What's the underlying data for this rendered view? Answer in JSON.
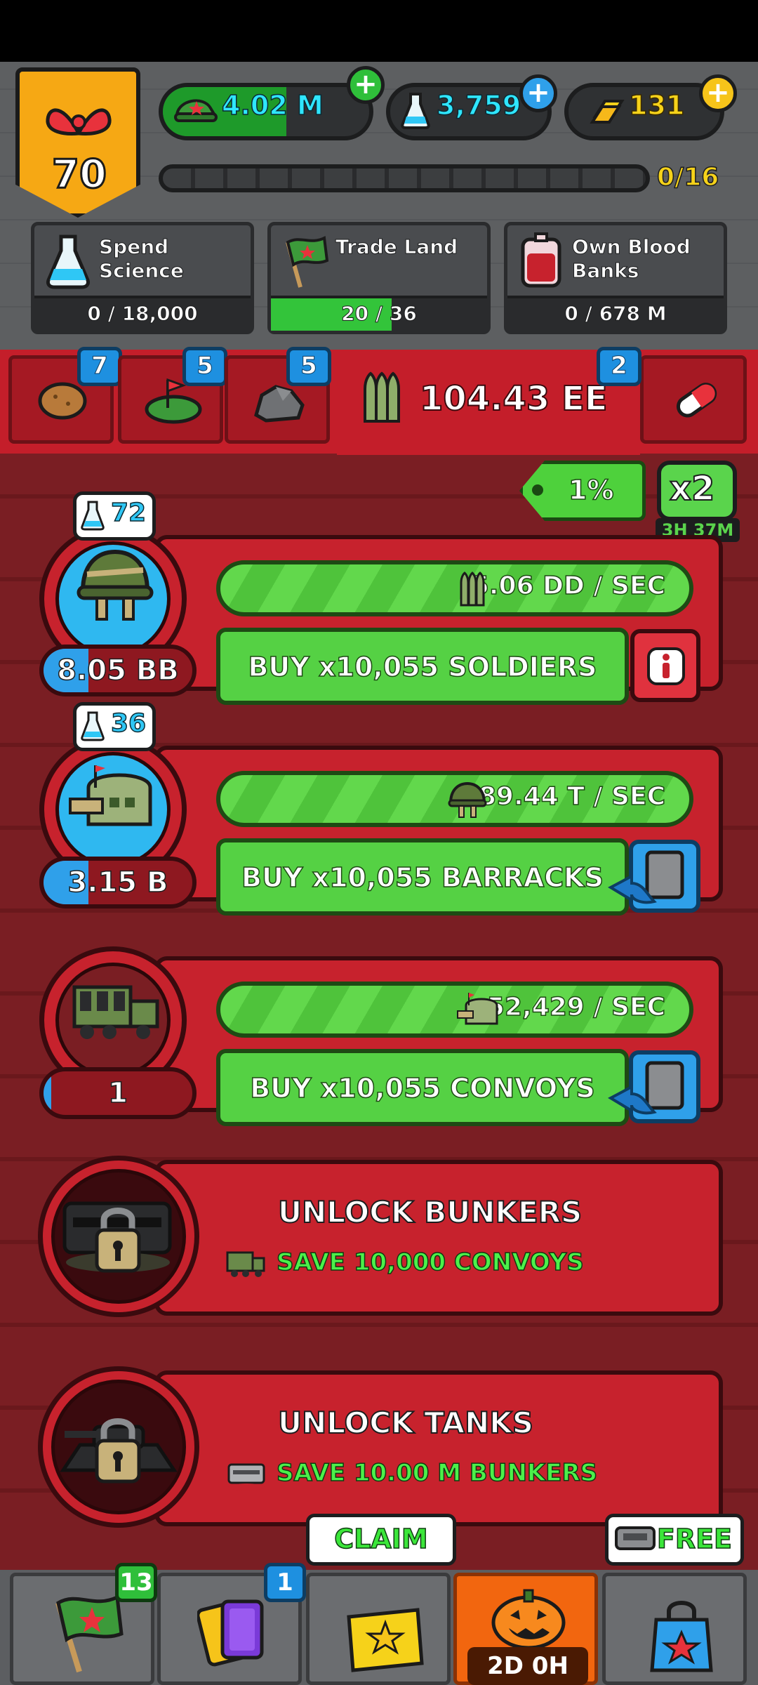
{
  "player": {
    "rank_level": "70"
  },
  "resources": {
    "cash": {
      "value": "4.02 M",
      "fill_fraction": 0.6
    },
    "science": {
      "value": "3,759"
    },
    "gold": {
      "value": "131"
    }
  },
  "xp": {
    "progress_text": "0/16",
    "fraction": 0.0
  },
  "goals": [
    {
      "label": "Spend Science",
      "progress_text": "0 / 18,000",
      "fraction": 0.0,
      "icon": "flask-icon"
    },
    {
      "label": "Trade Land",
      "progress_text": "20 / 36",
      "fraction": 0.56,
      "icon": "flag-icon"
    },
    {
      "label": "Own Blood Banks",
      "progress_text": "0 / 678 M",
      "fraction": 0.0,
      "icon": "blood-bag-icon"
    }
  ],
  "tabs": [
    {
      "icon": "potato-icon",
      "badge": "7"
    },
    {
      "icon": "land-flag-icon",
      "badge": "5"
    },
    {
      "icon": "ore-icon",
      "badge": "5"
    },
    {
      "icon": "pill-icon",
      "badge": "2"
    }
  ],
  "currency": {
    "value": "104.43 EE",
    "icon": "ammo-icon"
  },
  "multiplier": {
    "percent": "1%",
    "boost_label": "x2",
    "boost_timer": "3H 37M"
  },
  "units": [
    {
      "name": "soldiers",
      "science_cost": "72",
      "count": "8.05 BB",
      "count_fraction": 0.3,
      "rate": "5.06 DD / SEC",
      "buy_label": "BUY x10,055 SOLDIERS",
      "side_button": "info"
    },
    {
      "name": "barracks",
      "science_cost": "36",
      "count": "3.15 B",
      "count_fraction": 0.3,
      "rate": "289.44 T / SEC",
      "buy_label": "BUY x10,055 BARRACKS",
      "side_button": "auto"
    },
    {
      "name": "convoys",
      "count": "1",
      "count_fraction": 0.05,
      "rate": "52,429 / SEC",
      "buy_label": "BUY x10,055 CONVOYS",
      "side_button": "auto"
    }
  ],
  "locked": [
    {
      "title": "UNLOCK BUNKERS",
      "requirement": "SAVE 10,000 CONVOYS"
    },
    {
      "title": "UNLOCK TANKS",
      "requirement": "SAVE 10.00 M BUNKERS"
    }
  ],
  "nav": {
    "flag_badge": "13",
    "cards_badge": "1",
    "claim_label": "CLAIM",
    "event_timer": "2D 0H",
    "free_label": "FREE"
  },
  "colors": {
    "red_panel": "#c7222d",
    "green_button": "#55d144",
    "blue_accent": "#2fa0ea",
    "gold": "#f6a814"
  }
}
